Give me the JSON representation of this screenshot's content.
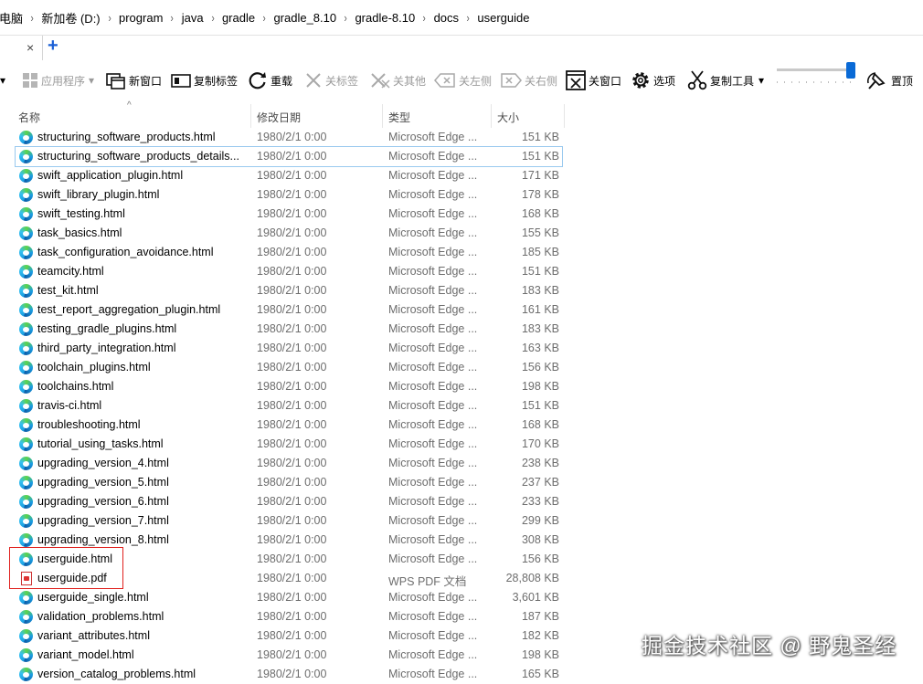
{
  "address_bar": {
    "crumbs": [
      "此电脑",
      "新加卷 (D:)",
      "program",
      "java",
      "gradle",
      "gradle_8.10",
      "gradle-8.10",
      "docs",
      "userguide"
    ]
  },
  "tabs": {
    "close_glyph": "×",
    "add_glyph": "+"
  },
  "toolbar": {
    "items": [
      {
        "label": "应用程序",
        "icon": "windows-icon",
        "enabled": false
      },
      {
        "label": "新窗口",
        "icon": "new-window-icon",
        "enabled": true
      },
      {
        "label": "复制标签",
        "icon": "duplicate-tab-icon",
        "enabled": true
      },
      {
        "label": "重载",
        "icon": "reload-icon",
        "enabled": true
      },
      {
        "label": "关标签",
        "icon": "close-tab-icon",
        "enabled": false
      },
      {
        "label": "关其他",
        "icon": "close-others-icon",
        "enabled": false
      },
      {
        "label": "关左侧",
        "icon": "close-left-icon",
        "enabled": false
      },
      {
        "label": "关右侧",
        "icon": "close-right-icon",
        "enabled": false
      },
      {
        "label": "关窗口",
        "icon": "close-window-icon",
        "enabled": true
      },
      {
        "label": "选项",
        "icon": "gear-icon",
        "enabled": true
      },
      {
        "label": "复制工具",
        "icon": "scissors-icon",
        "enabled": true
      },
      {
        "label": "置顶",
        "icon": "pin-icon",
        "enabled": true
      }
    ],
    "opacity_slider_level": 0.95
  },
  "columns": {
    "name": "名称",
    "date": "修改日期",
    "type": "类型",
    "size": "大小"
  },
  "files": [
    {
      "name": "structuring_software_products.html",
      "date": "1980/2/1 0:00",
      "type": "Microsoft Edge ...",
      "size": "151 KB",
      "icon": "edge-icon"
    },
    {
      "name": "structuring_software_products_details...",
      "date": "1980/2/1 0:00",
      "type": "Microsoft Edge ...",
      "size": "151 KB",
      "icon": "edge-icon"
    },
    {
      "name": "swift_application_plugin.html",
      "date": "1980/2/1 0:00",
      "type": "Microsoft Edge ...",
      "size": "171 KB",
      "icon": "edge-icon"
    },
    {
      "name": "swift_library_plugin.html",
      "date": "1980/2/1 0:00",
      "type": "Microsoft Edge ...",
      "size": "178 KB",
      "icon": "edge-icon"
    },
    {
      "name": "swift_testing.html",
      "date": "1980/2/1 0:00",
      "type": "Microsoft Edge ...",
      "size": "168 KB",
      "icon": "edge-icon"
    },
    {
      "name": "task_basics.html",
      "date": "1980/2/1 0:00",
      "type": "Microsoft Edge ...",
      "size": "155 KB",
      "icon": "edge-icon"
    },
    {
      "name": "task_configuration_avoidance.html",
      "date": "1980/2/1 0:00",
      "type": "Microsoft Edge ...",
      "size": "185 KB",
      "icon": "edge-icon"
    },
    {
      "name": "teamcity.html",
      "date": "1980/2/1 0:00",
      "type": "Microsoft Edge ...",
      "size": "151 KB",
      "icon": "edge-icon"
    },
    {
      "name": "test_kit.html",
      "date": "1980/2/1 0:00",
      "type": "Microsoft Edge ...",
      "size": "183 KB",
      "icon": "edge-icon"
    },
    {
      "name": "test_report_aggregation_plugin.html",
      "date": "1980/2/1 0:00",
      "type": "Microsoft Edge ...",
      "size": "161 KB",
      "icon": "edge-icon"
    },
    {
      "name": "testing_gradle_plugins.html",
      "date": "1980/2/1 0:00",
      "type": "Microsoft Edge ...",
      "size": "183 KB",
      "icon": "edge-icon"
    },
    {
      "name": "third_party_integration.html",
      "date": "1980/2/1 0:00",
      "type": "Microsoft Edge ...",
      "size": "163 KB",
      "icon": "edge-icon"
    },
    {
      "name": "toolchain_plugins.html",
      "date": "1980/2/1 0:00",
      "type": "Microsoft Edge ...",
      "size": "156 KB",
      "icon": "edge-icon"
    },
    {
      "name": "toolchains.html",
      "date": "1980/2/1 0:00",
      "type": "Microsoft Edge ...",
      "size": "198 KB",
      "icon": "edge-icon"
    },
    {
      "name": "travis-ci.html",
      "date": "1980/2/1 0:00",
      "type": "Microsoft Edge ...",
      "size": "151 KB",
      "icon": "edge-icon"
    },
    {
      "name": "troubleshooting.html",
      "date": "1980/2/1 0:00",
      "type": "Microsoft Edge ...",
      "size": "168 KB",
      "icon": "edge-icon"
    },
    {
      "name": "tutorial_using_tasks.html",
      "date": "1980/2/1 0:00",
      "type": "Microsoft Edge ...",
      "size": "170 KB",
      "icon": "edge-icon"
    },
    {
      "name": "upgrading_version_4.html",
      "date": "1980/2/1 0:00",
      "type": "Microsoft Edge ...",
      "size": "238 KB",
      "icon": "edge-icon"
    },
    {
      "name": "upgrading_version_5.html",
      "date": "1980/2/1 0:00",
      "type": "Microsoft Edge ...",
      "size": "237 KB",
      "icon": "edge-icon"
    },
    {
      "name": "upgrading_version_6.html",
      "date": "1980/2/1 0:00",
      "type": "Microsoft Edge ...",
      "size": "233 KB",
      "icon": "edge-icon"
    },
    {
      "name": "upgrading_version_7.html",
      "date": "1980/2/1 0:00",
      "type": "Microsoft Edge ...",
      "size": "299 KB",
      "icon": "edge-icon"
    },
    {
      "name": "upgrading_version_8.html",
      "date": "1980/2/1 0:00",
      "type": "Microsoft Edge ...",
      "size": "308 KB",
      "icon": "edge-icon"
    },
    {
      "name": "userguide.html",
      "date": "1980/2/1 0:00",
      "type": "Microsoft Edge ...",
      "size": "156 KB",
      "icon": "edge-icon"
    },
    {
      "name": "userguide.pdf",
      "date": "1980/2/1 0:00",
      "type": "WPS PDF 文档",
      "size": "28,808 KB",
      "icon": "pdf-icon"
    },
    {
      "name": "userguide_single.html",
      "date": "1980/2/1 0:00",
      "type": "Microsoft Edge ...",
      "size": "3,601 KB",
      "icon": "edge-icon"
    },
    {
      "name": "validation_problems.html",
      "date": "1980/2/1 0:00",
      "type": "Microsoft Edge ...",
      "size": "187 KB",
      "icon": "edge-icon"
    },
    {
      "name": "variant_attributes.html",
      "date": "1980/2/1 0:00",
      "type": "Microsoft Edge ...",
      "size": "182 KB",
      "icon": "edge-icon"
    },
    {
      "name": "variant_model.html",
      "date": "1980/2/1 0:00",
      "type": "Microsoft Edge ...",
      "size": "198 KB",
      "icon": "edge-icon"
    },
    {
      "name": "version_catalog_problems.html",
      "date": "1980/2/1 0:00",
      "type": "Microsoft Edge ...",
      "size": "165 KB",
      "icon": "edge-icon"
    }
  ],
  "selected_row": 1,
  "highlighted_rows": [
    22,
    23
  ],
  "watermark": "掘金技术社区 @ 野鬼圣经",
  "colors": {
    "accent": "#0a6ad6",
    "highlight_border": "#e0201d",
    "selection_border": "#99c9ef"
  }
}
